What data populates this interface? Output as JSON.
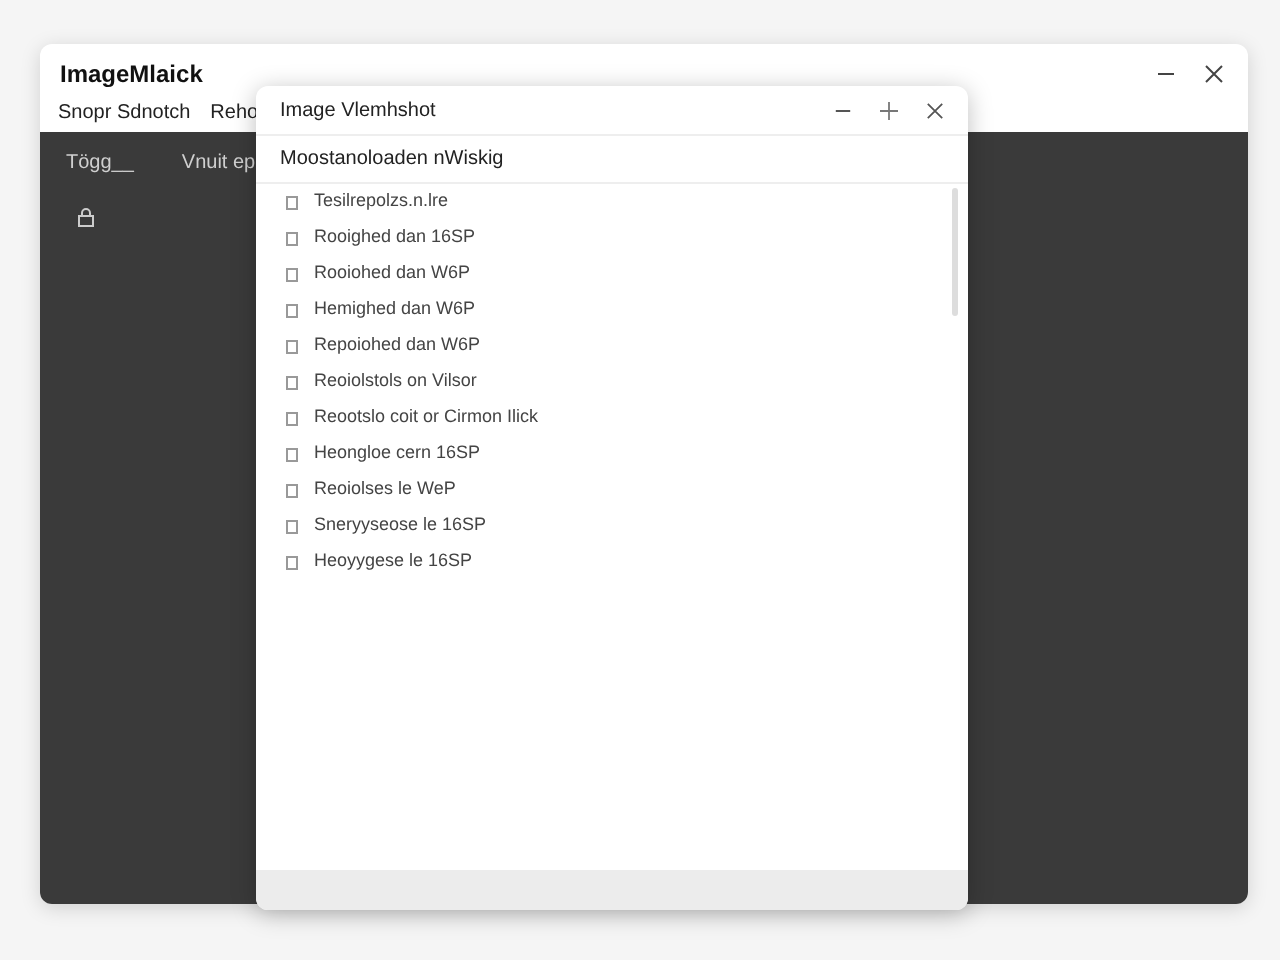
{
  "window": {
    "title": "ImageMlaick",
    "menu": [
      "Snopr Sdnotch",
      "Reho"
    ],
    "tabs": [
      "Tögg__",
      "Vnuit ep"
    ]
  },
  "dialog": {
    "title": "Image Vlemhshot",
    "header": "Moostanoloaden nWiskig",
    "items": [
      "Tesilrepolzs.n.lre",
      "Rooighed dan 16SP",
      "Rooiohed dan W6P",
      "Hemighed dan W6P",
      "Repoiohed dan W6P",
      "Reoiolstols on Vilsor",
      "Reootslo coit or Cirmon Ilick",
      "Heongloe cern 16SP",
      "Reoiolses le WeP",
      "Sneryyseose le 16SP",
      "Heoyygese le 16SP"
    ]
  }
}
